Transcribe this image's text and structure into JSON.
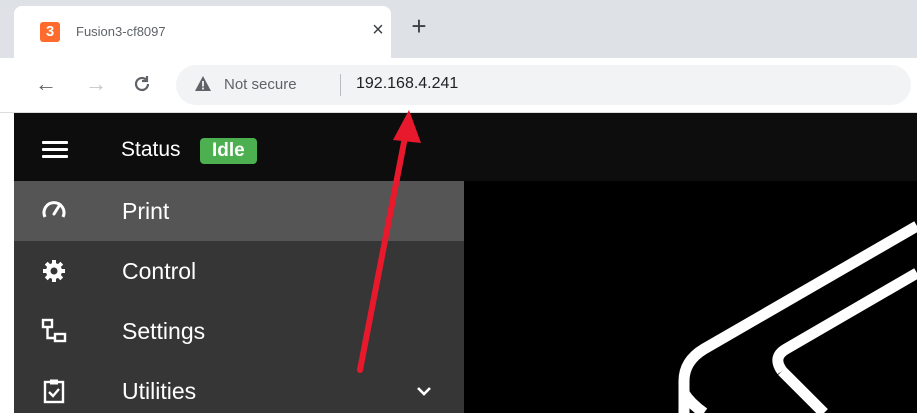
{
  "browser": {
    "tab": {
      "favicon": "3",
      "title": "Fusion3-cf8097",
      "close": "×"
    },
    "new_tab": "+",
    "nav": {
      "back": "←",
      "forward": "→",
      "reload": "C"
    },
    "omnibox": {
      "security_label": "Not secure",
      "url": "192.168.4.241"
    }
  },
  "app": {
    "status_label": "Status",
    "status_value": "Idle",
    "status_color": "#4caf50",
    "menu": [
      {
        "label": "Print",
        "icon": "speedometer-icon",
        "active": true
      },
      {
        "label": "Control",
        "icon": "gear-icon",
        "active": false
      },
      {
        "label": "Settings",
        "icon": "network-icon",
        "active": false
      },
      {
        "label": "Utilities",
        "icon": "clipboard-check-icon",
        "active": false,
        "expandable": true
      }
    ]
  },
  "colors": {
    "accent_arrow": "#e8192c",
    "drawer_bg": "#363636",
    "active_item_bg": "#555555"
  }
}
